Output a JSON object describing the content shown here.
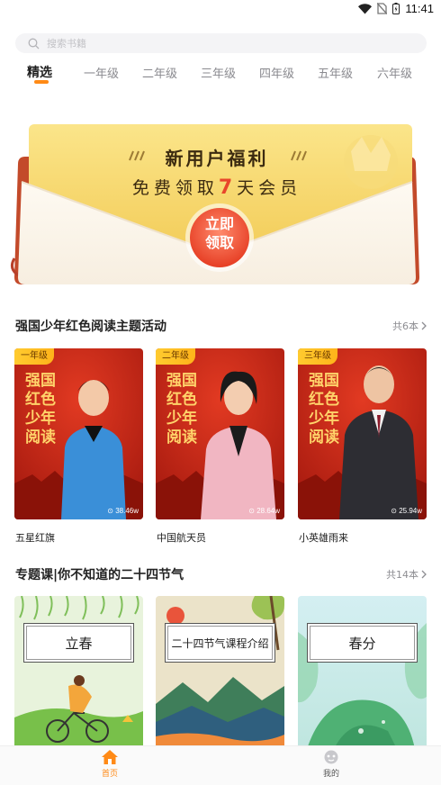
{
  "status_bar": {
    "time": "11:41",
    "icons": [
      "wifi-icon",
      "no-sim-icon",
      "battery-icon"
    ]
  },
  "search": {
    "placeholder": "搜索书籍"
  },
  "tabs": [
    {
      "label": "精选",
      "active": true
    },
    {
      "label": "一年级"
    },
    {
      "label": "二年级"
    },
    {
      "label": "三年级"
    },
    {
      "label": "四年级"
    },
    {
      "label": "五年级"
    },
    {
      "label": "六年级"
    }
  ],
  "banner": {
    "title": "新用户福利",
    "subtitle_pre": "免费领取",
    "subtitle_num": "7",
    "subtitle_post": "天会员",
    "button_line1": "立即",
    "button_line2": "领取"
  },
  "section1": {
    "title": "强国少年红色阅读主题活动",
    "more": "共6本",
    "cards": [
      {
        "tag": "一年级",
        "poster_text": "强国红色少年阅读",
        "views": "38.46w",
        "title": "五星红旗"
      },
      {
        "tag": "二年级",
        "poster_text": "强国红色少年阅读",
        "views": "28.64w",
        "title": "中国航天员"
      },
      {
        "tag": "三年级",
        "poster_text": "强国红色少年阅读",
        "views": "25.94w",
        "title": "小英雄雨来"
      }
    ]
  },
  "section2": {
    "title": "专题课|你不知道的二十四节气",
    "more": "共14本",
    "cards": [
      {
        "label": "立春"
      },
      {
        "label": "二十四节气课程介绍"
      },
      {
        "label": "春分"
      }
    ]
  },
  "bottom_nav": [
    {
      "label": "首页",
      "icon": "home-icon",
      "active": true
    },
    {
      "label": "我的",
      "icon": "profile-icon",
      "active": false
    }
  ],
  "colors": {
    "accent": "#ff8a16",
    "banner_red": "#e8452b",
    "tag_yellow": "#ffc12a"
  }
}
